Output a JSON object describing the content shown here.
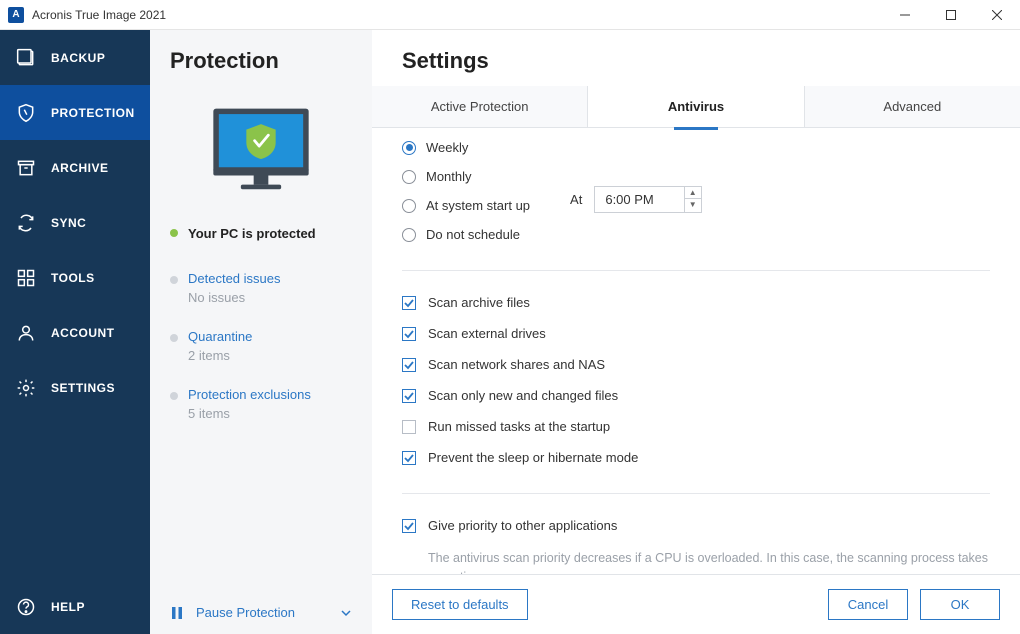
{
  "title": "Acronis True Image 2021",
  "sidebar": {
    "items": [
      {
        "label": "BACKUP"
      },
      {
        "label": "PROTECTION"
      },
      {
        "label": "ARCHIVE"
      },
      {
        "label": "SYNC"
      },
      {
        "label": "TOOLS"
      },
      {
        "label": "ACCOUNT"
      },
      {
        "label": "SETTINGS"
      }
    ],
    "help": "HELP"
  },
  "protection_panel": {
    "title": "Protection",
    "status": "Your PC is protected",
    "sections": [
      {
        "title": "Detected issues",
        "sub": "No issues"
      },
      {
        "title": "Quarantine",
        "sub": "2 items"
      },
      {
        "title": "Protection exclusions",
        "sub": "5 items"
      }
    ],
    "pause": "Pause Protection"
  },
  "settings": {
    "title": "Settings",
    "tabs": [
      "Active Protection",
      "Antivirus",
      "Advanced"
    ],
    "active_tab": "Antivirus",
    "schedule": {
      "options": [
        "Weekly",
        "Monthly",
        "At system start up",
        "Do not schedule"
      ],
      "selected": "Weekly",
      "at_label": "At",
      "time": "6:00 PM"
    },
    "checks": [
      {
        "label": "Scan archive files",
        "checked": true
      },
      {
        "label": "Scan external drives",
        "checked": true
      },
      {
        "label": "Scan network shares and NAS",
        "checked": true
      },
      {
        "label": "Scan only new and changed files",
        "checked": true
      },
      {
        "label": "Run missed tasks at the startup",
        "checked": false
      },
      {
        "label": "Prevent the sleep or hibernate mode",
        "checked": true
      }
    ],
    "priority": {
      "label": "Give priority to other applications",
      "checked": true,
      "desc": "The antivirus scan priority decreases if a CPU is overloaded. In this case, the scanning process takes more time."
    },
    "buttons": {
      "reset": "Reset to defaults",
      "cancel": "Cancel",
      "ok": "OK"
    }
  }
}
